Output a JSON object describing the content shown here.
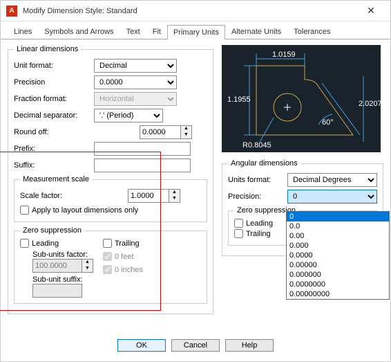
{
  "window": {
    "title": "Modify Dimension Style: Standard",
    "app_icon": "A"
  },
  "tabs": [
    "Lines",
    "Symbols and Arrows",
    "Text",
    "Fit",
    "Primary Units",
    "Alternate Units",
    "Tolerances"
  ],
  "active_tab": "Primary Units",
  "linear": {
    "legend": "Linear dimensions",
    "unit_format_label": "Unit format:",
    "unit_format": "Decimal",
    "precision_label": "Precision",
    "precision": "0.0000",
    "fraction_label": "Fraction format:",
    "fraction": "Horizontal",
    "decimal_sep_label": "Decimal separator:",
    "decimal_sep": "'.' (Period)",
    "round_label": "Round off:",
    "round": "0.0000",
    "prefix_label": "Prefix:",
    "prefix": "",
    "suffix_label": "Suffix:",
    "suffix": ""
  },
  "measure": {
    "legend": "Measurement scale",
    "scale_label": "Scale factor:",
    "scale": "1.0000",
    "apply_label": "Apply to layout dimensions only"
  },
  "zero": {
    "legend": "Zero suppression",
    "leading": "Leading",
    "trailing": "Trailing",
    "subunit_factor_label": "Sub-units factor:",
    "subunit_factor": "100.0000",
    "subunit_suffix_label": "Sub-unit suffix:",
    "subunit_suffix": "",
    "feet": "0 feet",
    "inches": "0 inches"
  },
  "preview": {
    "d1": "1.0159",
    "d2": "1.1955",
    "d3": "2.0207",
    "d4": "R0.8045",
    "angle": "60°"
  },
  "angular": {
    "legend": "Angular dimensions",
    "units_label": "Units format:",
    "units": "Decimal Degrees",
    "precision_label": "Precision:",
    "precision": "0",
    "options": [
      "0",
      "0.0",
      "0.00",
      "0.000",
      "0.0000",
      "0.00000",
      "0.000000",
      "0.0000000",
      "0.00000000"
    ],
    "zero_legend": "Zero suppression",
    "leading": "Leading",
    "trailing": "Trailing"
  },
  "buttons": {
    "ok": "OK",
    "cancel": "Cancel",
    "help": "Help"
  }
}
